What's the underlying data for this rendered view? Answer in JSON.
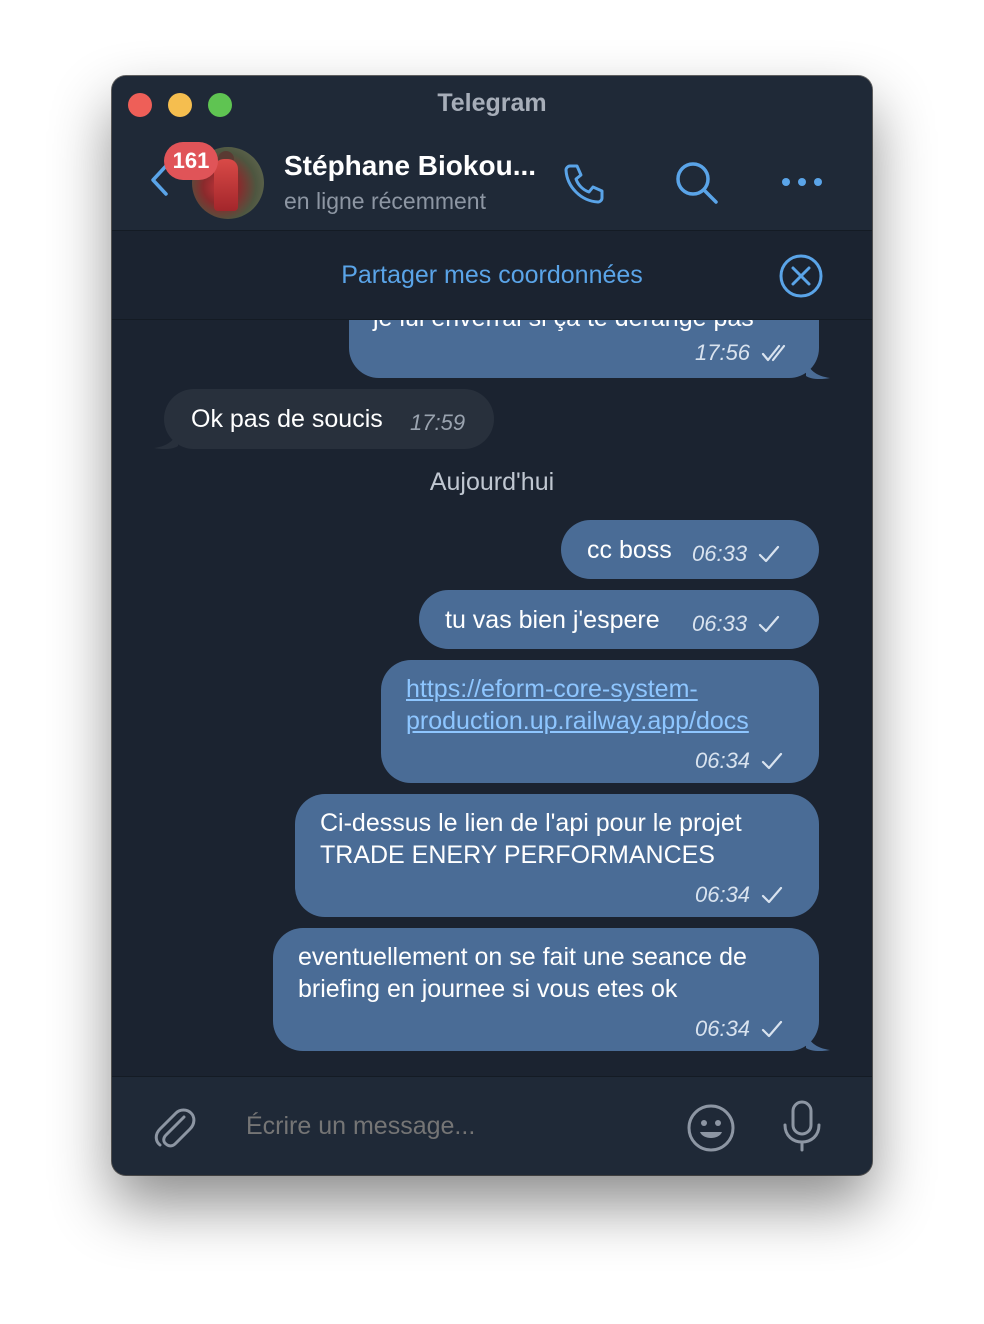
{
  "window": {
    "title": "Telegram"
  },
  "header": {
    "back_badge": "161",
    "contact_name": "Stéphane Biokou...",
    "contact_status": "en ligne récemment"
  },
  "sharebar": {
    "label": "Partager mes coordonnées"
  },
  "messages": {
    "partial_top": {
      "text": "je lui enverrai si ça te dérange pas",
      "time": "17:56",
      "status": "read"
    },
    "incoming_1": {
      "text": "Ok pas de soucis",
      "time": "17:59"
    },
    "date_separator": "Aujourd'hui",
    "out_1": {
      "text": "cc boss",
      "time": "06:33",
      "status": "sent"
    },
    "out_2": {
      "text": "tu vas bien j'espere",
      "time": "06:33",
      "status": "sent"
    },
    "out_3": {
      "link_line1": "https://eform-core-system-",
      "link_line2": "production.up.railway.app/docs",
      "time": "06:34",
      "status": "sent"
    },
    "out_4": {
      "line1": "Ci-dessus le lien de l'api pour le projet",
      "line2": "TRADE ENERY PERFORMANCES",
      "time": "06:34",
      "status": "sent"
    },
    "out_5": {
      "line1": "eventuellement on se fait une seance de",
      "line2": "briefing en journee si vous etes ok",
      "time": "06:34",
      "status": "sent"
    }
  },
  "composer": {
    "placeholder": "Écrire un message..."
  },
  "colors": {
    "outgoing_bubble": "#4a6c96",
    "incoming_bubble": "#28303c",
    "accent": "#5aa4e8",
    "badge": "#e05458",
    "background": "#1b2330"
  },
  "icons": [
    "back-icon",
    "phone-icon",
    "search-icon",
    "more-icon",
    "close-circle-icon",
    "attach-icon",
    "emoji-icon",
    "mic-icon",
    "check-icon",
    "double-check-icon"
  ]
}
